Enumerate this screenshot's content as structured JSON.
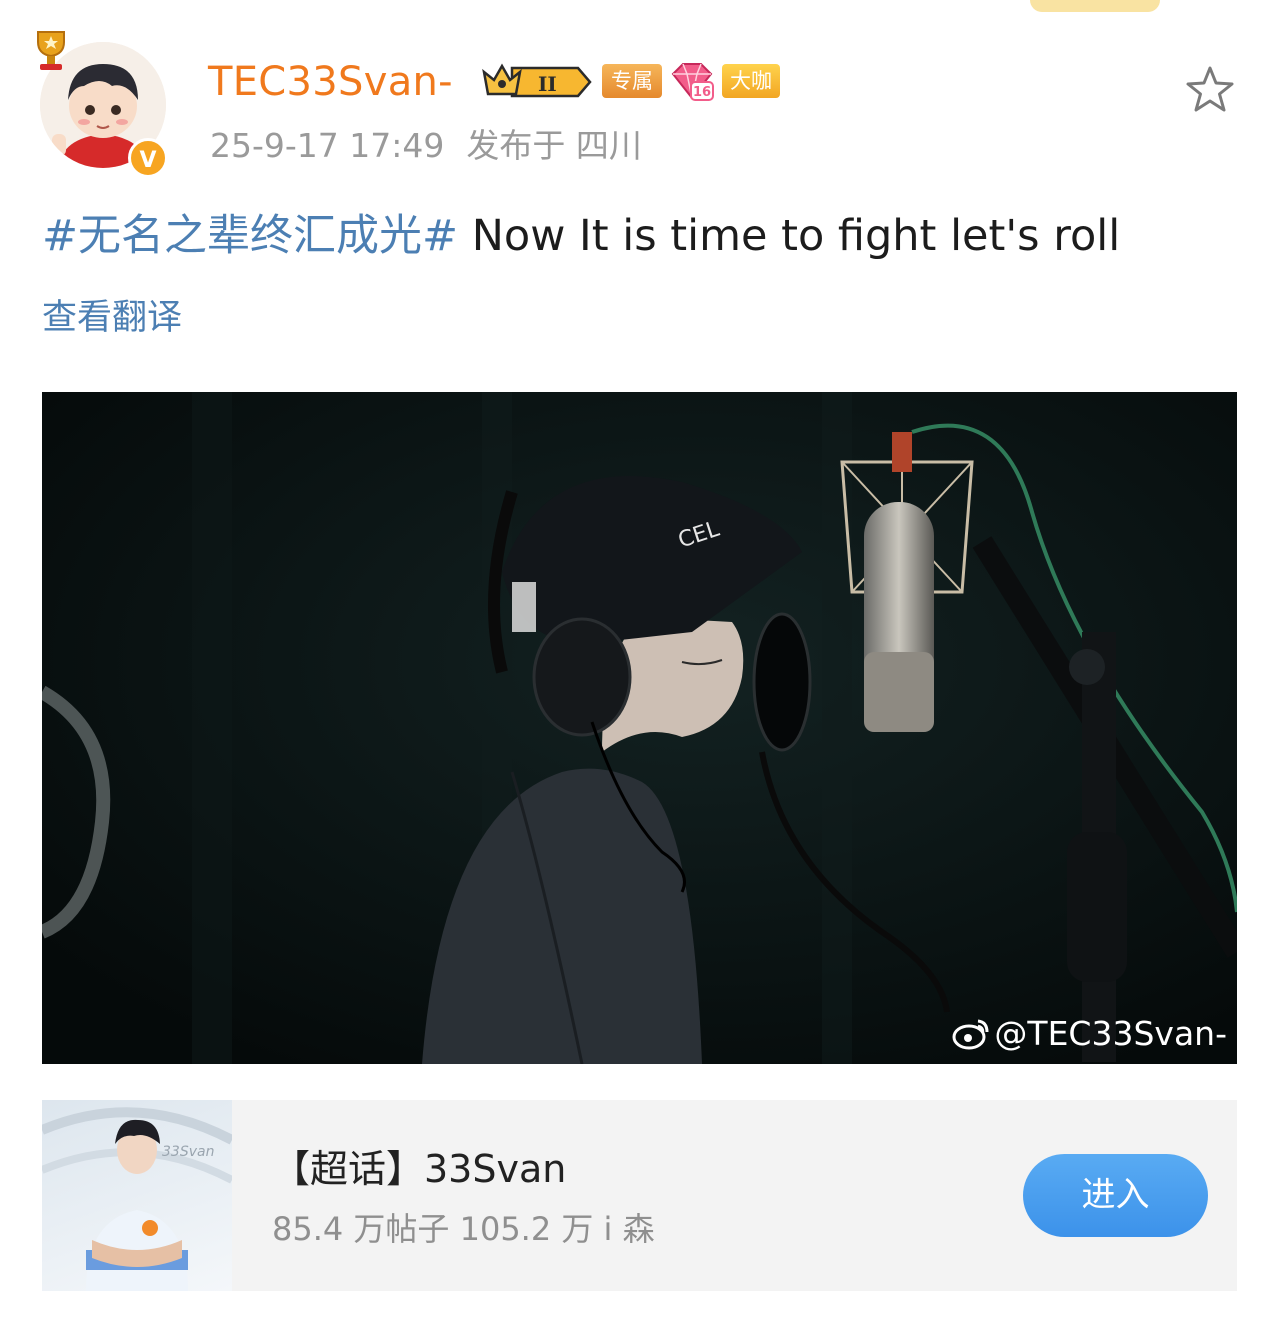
{
  "header": {
    "username": "TEC33Svan-",
    "badges": {
      "rank": "II",
      "exclusive": "专属",
      "gem_level": "16",
      "vip": "大咖"
    },
    "verified_mark": "V",
    "timestamp": "25-9-17 17:49",
    "location": "发布于 四川"
  },
  "post": {
    "topic": "#无名之辈终汇成光#",
    "text": "Now It is time to fight let's roll",
    "translate_label": "查看翻译"
  },
  "photo": {
    "watermark": "@TEC33Svan-",
    "cap_text": "CEL"
  },
  "super_topic": {
    "title": "【超话】33Svan",
    "stats": "85.4 万帖子 105.2 万 i 森",
    "enter_label": "进入",
    "thumb_caption": "33Svan"
  },
  "colors": {
    "username": "#f0791d",
    "topic_link": "#4c7fb3",
    "button": "#3c92ea"
  },
  "icons": [
    "trophy-icon",
    "verified-icon",
    "crown-badge-icon",
    "gem-badge-icon",
    "star-favorite-icon",
    "weibo-logo-icon"
  ]
}
